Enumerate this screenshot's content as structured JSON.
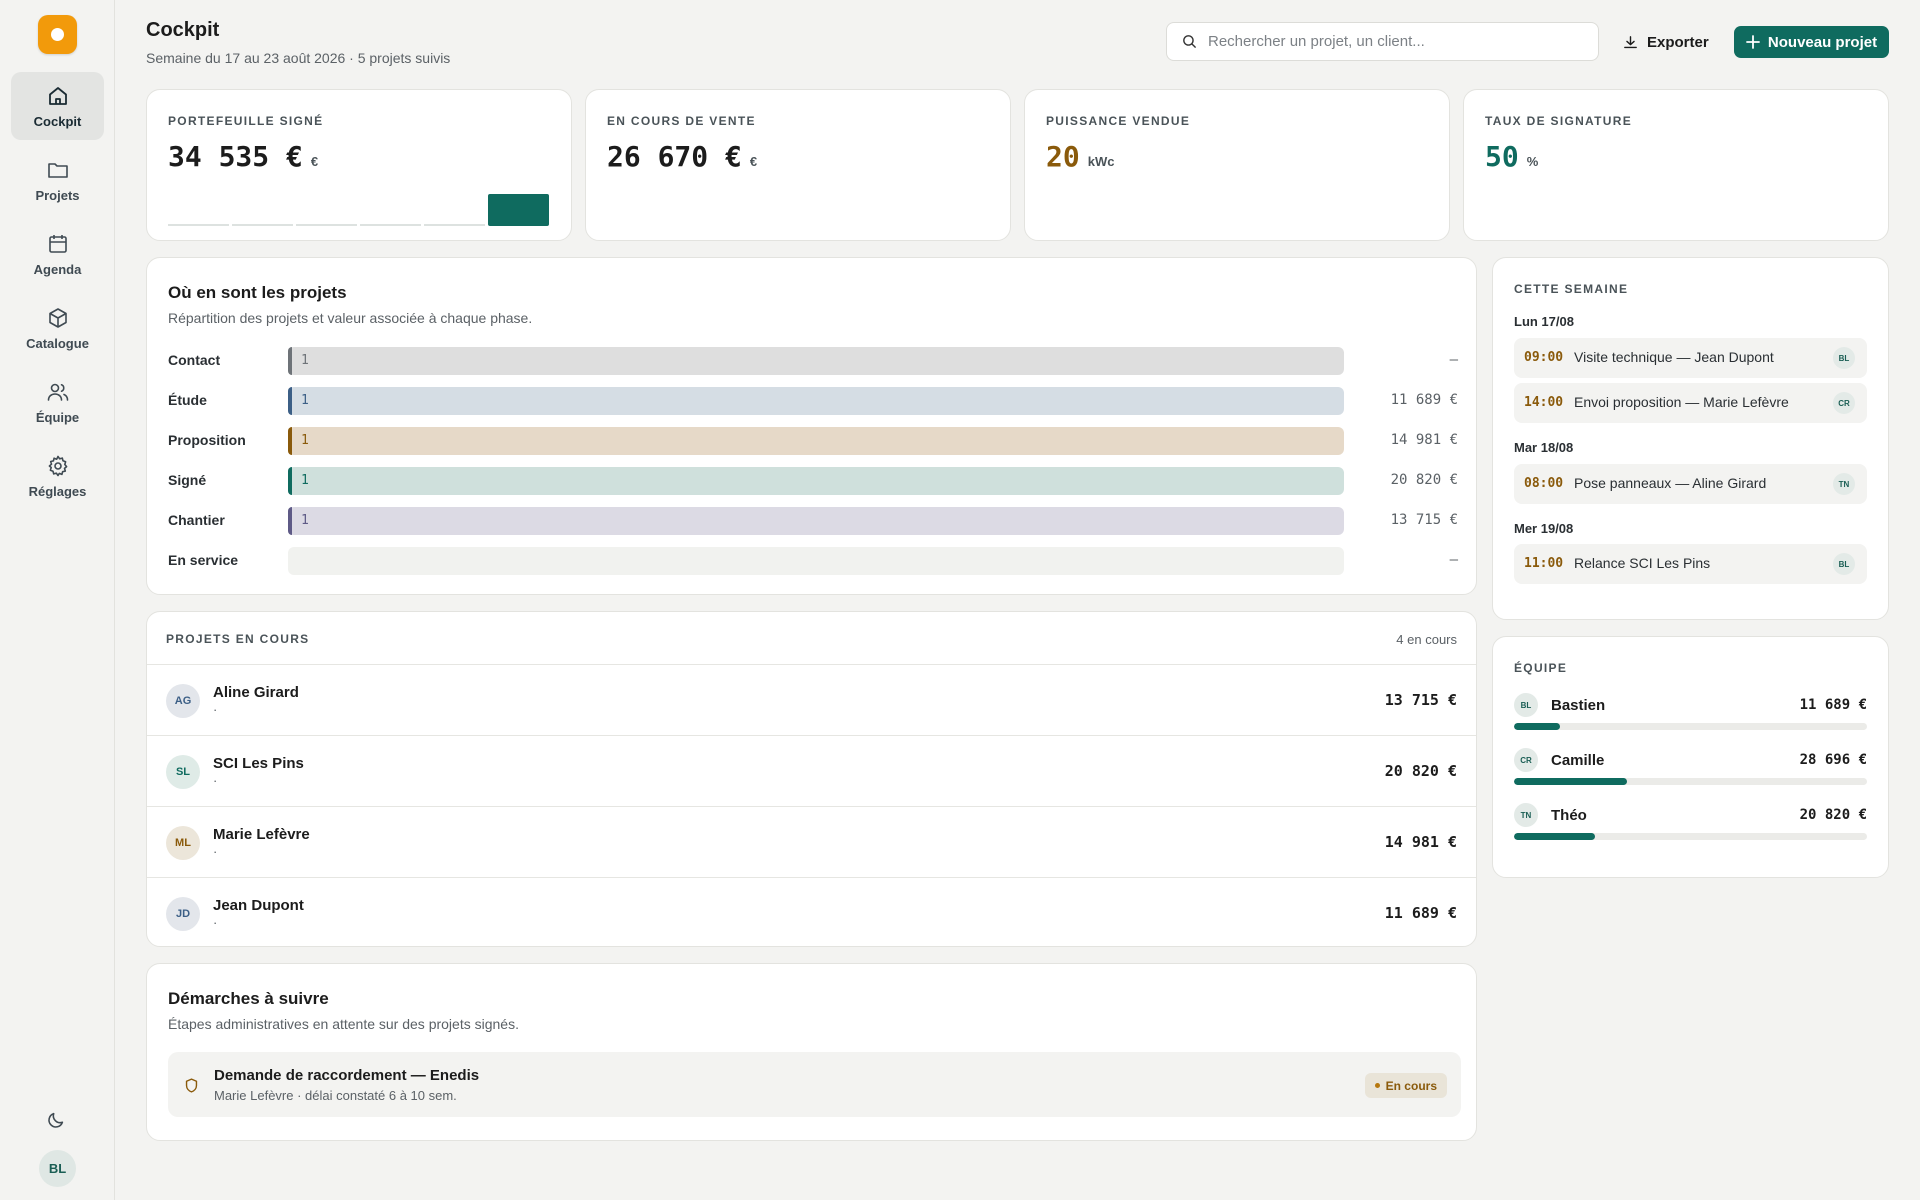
{
  "app": {
    "logo": "app-logo"
  },
  "nav": {
    "items": [
      {
        "label": "Cockpit",
        "icon": "home-icon",
        "active": true
      },
      {
        "label": "Projets",
        "icon": "folder-icon",
        "active": false
      },
      {
        "label": "Agenda",
        "icon": "calendar-icon",
        "active": false
      },
      {
        "label": "Catalogue",
        "icon": "box-icon",
        "active": false
      },
      {
        "label": "Équipe",
        "icon": "users-icon",
        "active": false
      },
      {
        "label": "Réglages",
        "icon": "gear-icon",
        "active": false
      }
    ],
    "user_initials": "BL"
  },
  "header": {
    "title": "Cockpit",
    "subtitle": "Semaine du 17 au 23 août 2026 · 5 projets suivis",
    "search_placeholder": "Rechercher un projet, un client...",
    "export_label": "Exporter",
    "new_label": "Nouveau projet"
  },
  "kpis": [
    {
      "label": "PORTEFEUILLE SIGNÉ",
      "value": "34 535 €",
      "unit": "€"
    },
    {
      "label": "EN COURS DE VENTE",
      "value": "26 670 €",
      "unit": "€"
    },
    {
      "label": "PUISSANCE VENDUE",
      "value": "20",
      "unit": "kWc"
    },
    {
      "label": "TAUX DE SIGNATURE",
      "value": "50",
      "unit": "%"
    }
  ],
  "pipeline": {
    "title": "Où en sont les projets",
    "subtitle": "Répartition des projets et valeur associée à chaque phase.",
    "phases": [
      {
        "name": "Contact",
        "count": "1",
        "value": "–"
      },
      {
        "name": "Étude",
        "count": "1",
        "value": "11 689 €"
      },
      {
        "name": "Proposition",
        "count": "1",
        "value": "14 981 €"
      },
      {
        "name": "Signé",
        "count": "1",
        "value": "20 820 €"
      },
      {
        "name": "Chantier",
        "count": "1",
        "value": "13 715 €"
      },
      {
        "name": "En service",
        "count": "",
        "value": "–"
      }
    ]
  },
  "projects": {
    "label": "PROJETS EN COURS",
    "count": "4 en cours",
    "rows": [
      {
        "initials": "AG",
        "name": "Aline Girard",
        "sub": "·",
        "amount": "13 715 €"
      },
      {
        "initials": "SL",
        "name": "SCI Les Pins",
        "sub": "·",
        "amount": "20 820 €"
      },
      {
        "initials": "ML",
        "name": "Marie Lefèvre",
        "sub": "·",
        "amount": "14 981 €"
      },
      {
        "initials": "JD",
        "name": "Jean Dupont",
        "sub": "·",
        "amount": "11 689 €"
      }
    ]
  },
  "tasks": {
    "title": "Démarches à suivre",
    "subtitle": "Étapes administratives en attente sur des projets signés.",
    "items": [
      {
        "title": "Demande de raccordement — Enedis",
        "sub": "Marie Lefèvre · délai constaté 6 à 10 sem.",
        "status": "En cours",
        "icon": "shield-icon"
      }
    ]
  },
  "week": {
    "label": "CETTE SEMAINE",
    "days": [
      {
        "day": "Lun 17/08",
        "events": [
          {
            "time": "09:00",
            "title": "Visite technique — Jean Dupont",
            "who": "BL"
          },
          {
            "time": "14:00",
            "title": "Envoi proposition — Marie Lefèvre",
            "who": "CR"
          }
        ]
      },
      {
        "day": "Mar 18/08",
        "events": [
          {
            "time": "08:00",
            "title": "Pose panneaux — Aline Girard",
            "who": "TN"
          }
        ]
      },
      {
        "day": "Mer 19/08",
        "events": [
          {
            "time": "11:00",
            "title": "Relance SCI Les Pins",
            "who": "BL"
          }
        ]
      }
    ]
  },
  "team": {
    "label": "ÉQUIPE",
    "members": [
      {
        "initials": "BL",
        "name": "Bastien",
        "amount": "11 689 €",
        "share": 0.13
      },
      {
        "initials": "CR",
        "name": "Camille",
        "amount": "28 696 €",
        "share": 0.32
      },
      {
        "initials": "TN",
        "name": "Théo",
        "amount": "20 820 €",
        "share": 0.23
      }
    ]
  },
  "colors": {
    "accent": "#0f6b5f",
    "amber": "#8a5a0b",
    "logo": "#f29a0b"
  }
}
